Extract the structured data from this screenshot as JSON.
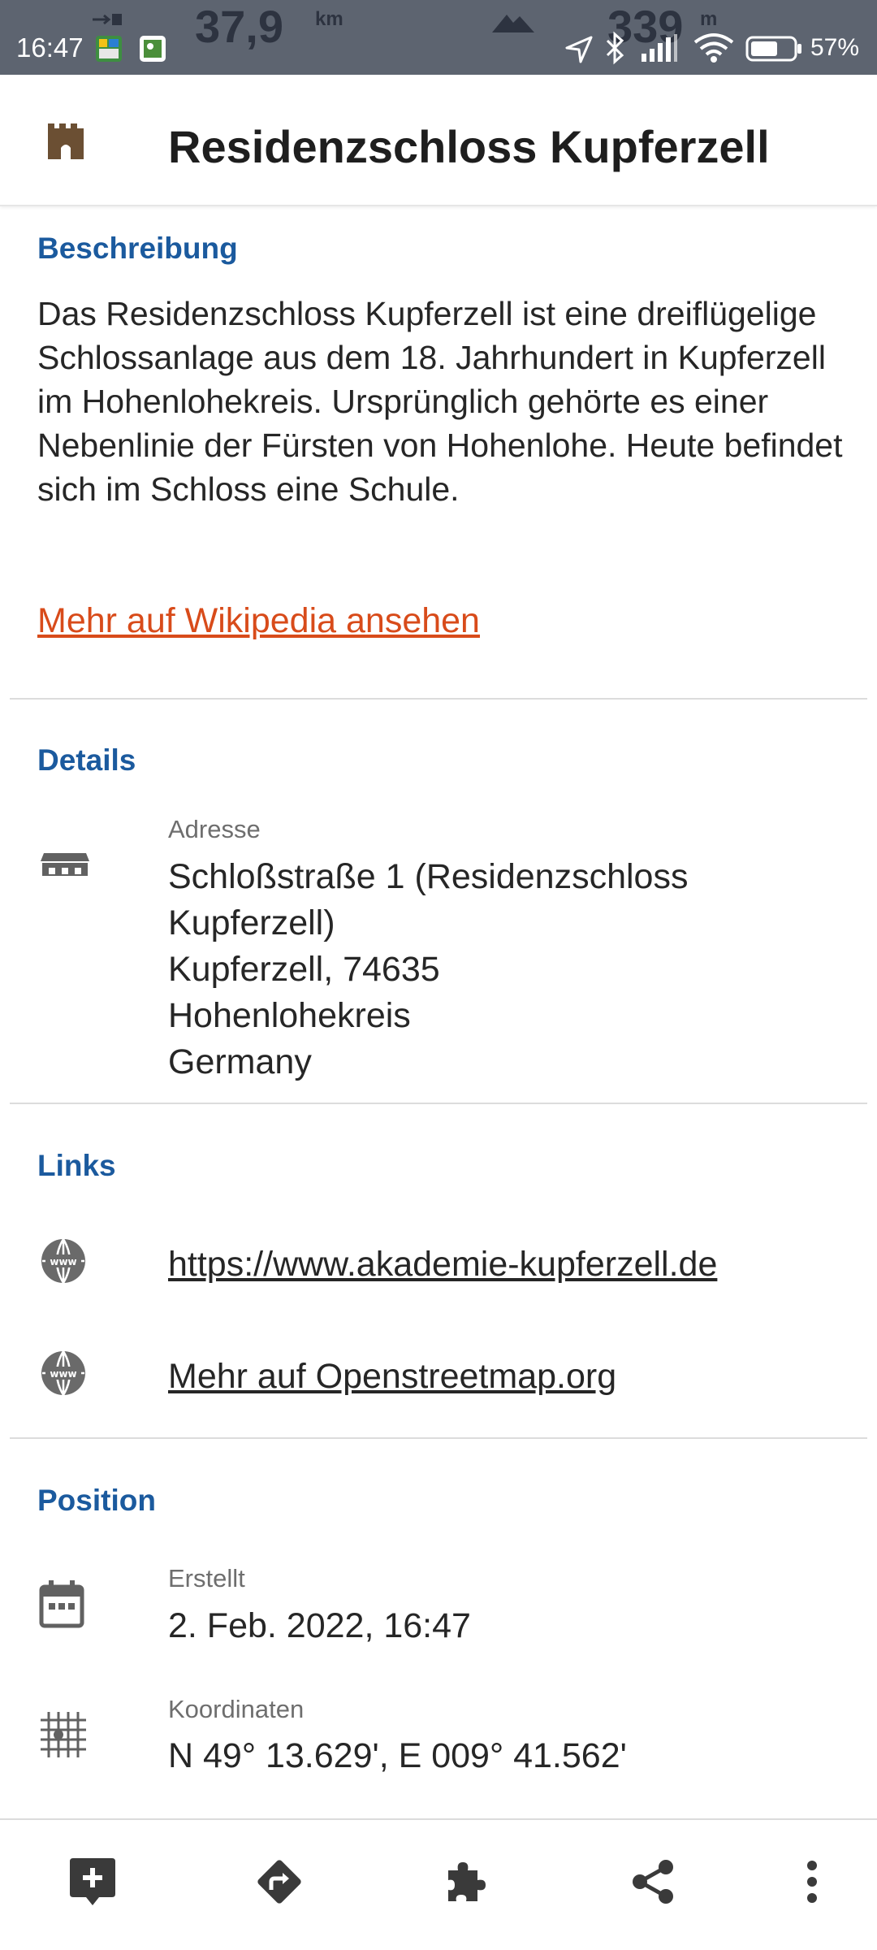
{
  "status_bar": {
    "time": "16:47",
    "overlay_distance": "37,9",
    "overlay_distance_unit": "km",
    "overlay_altitude": "339",
    "overlay_altitude_unit": "m",
    "battery_percent": "57%"
  },
  "header": {
    "title": "Residenzschloss Kupferzell",
    "icon": "castle-icon"
  },
  "description": {
    "section_title": "Beschreibung",
    "text": "Das Residenzschloss Kupferzell ist eine dreiflügelige Schlossanlage aus dem 18. Jahrhundert in Kupferzell im Hohenlohekreis. Ursprünglich gehörte es einer Nebenlinie der Fürsten von Hohenlohe. Heute befindet sich im Schloss eine Schule.",
    "link_label": "Mehr auf Wikipedia ansehen"
  },
  "details": {
    "section_title": "Details",
    "address_label": "Adresse",
    "address_lines": [
      "Schloßstraße 1 (Residenzschloss",
      "Kupferzell)",
      "Kupferzell, 74635",
      "Hohenlohekreis",
      "Germany"
    ]
  },
  "links": {
    "section_title": "Links",
    "items": [
      "https://www.akademie-kupferzell.de",
      "Mehr auf Openstreetmap.org"
    ]
  },
  "position": {
    "section_title": "Position",
    "created_label": "Erstellt",
    "created_value": "2. Feb. 2022, 16:47",
    "coords_label": "Koordinaten",
    "coords_value": "N 49° 13.629', E 009° 41.562'"
  },
  "colors": {
    "accent_blue": "#1b5a9e",
    "link_orange": "#d84b1a",
    "status_bar": "#5d6470"
  },
  "bottom_nav": [
    "add-note-icon",
    "directions-icon",
    "puzzle-icon",
    "share-icon",
    "more-vert-icon"
  ]
}
